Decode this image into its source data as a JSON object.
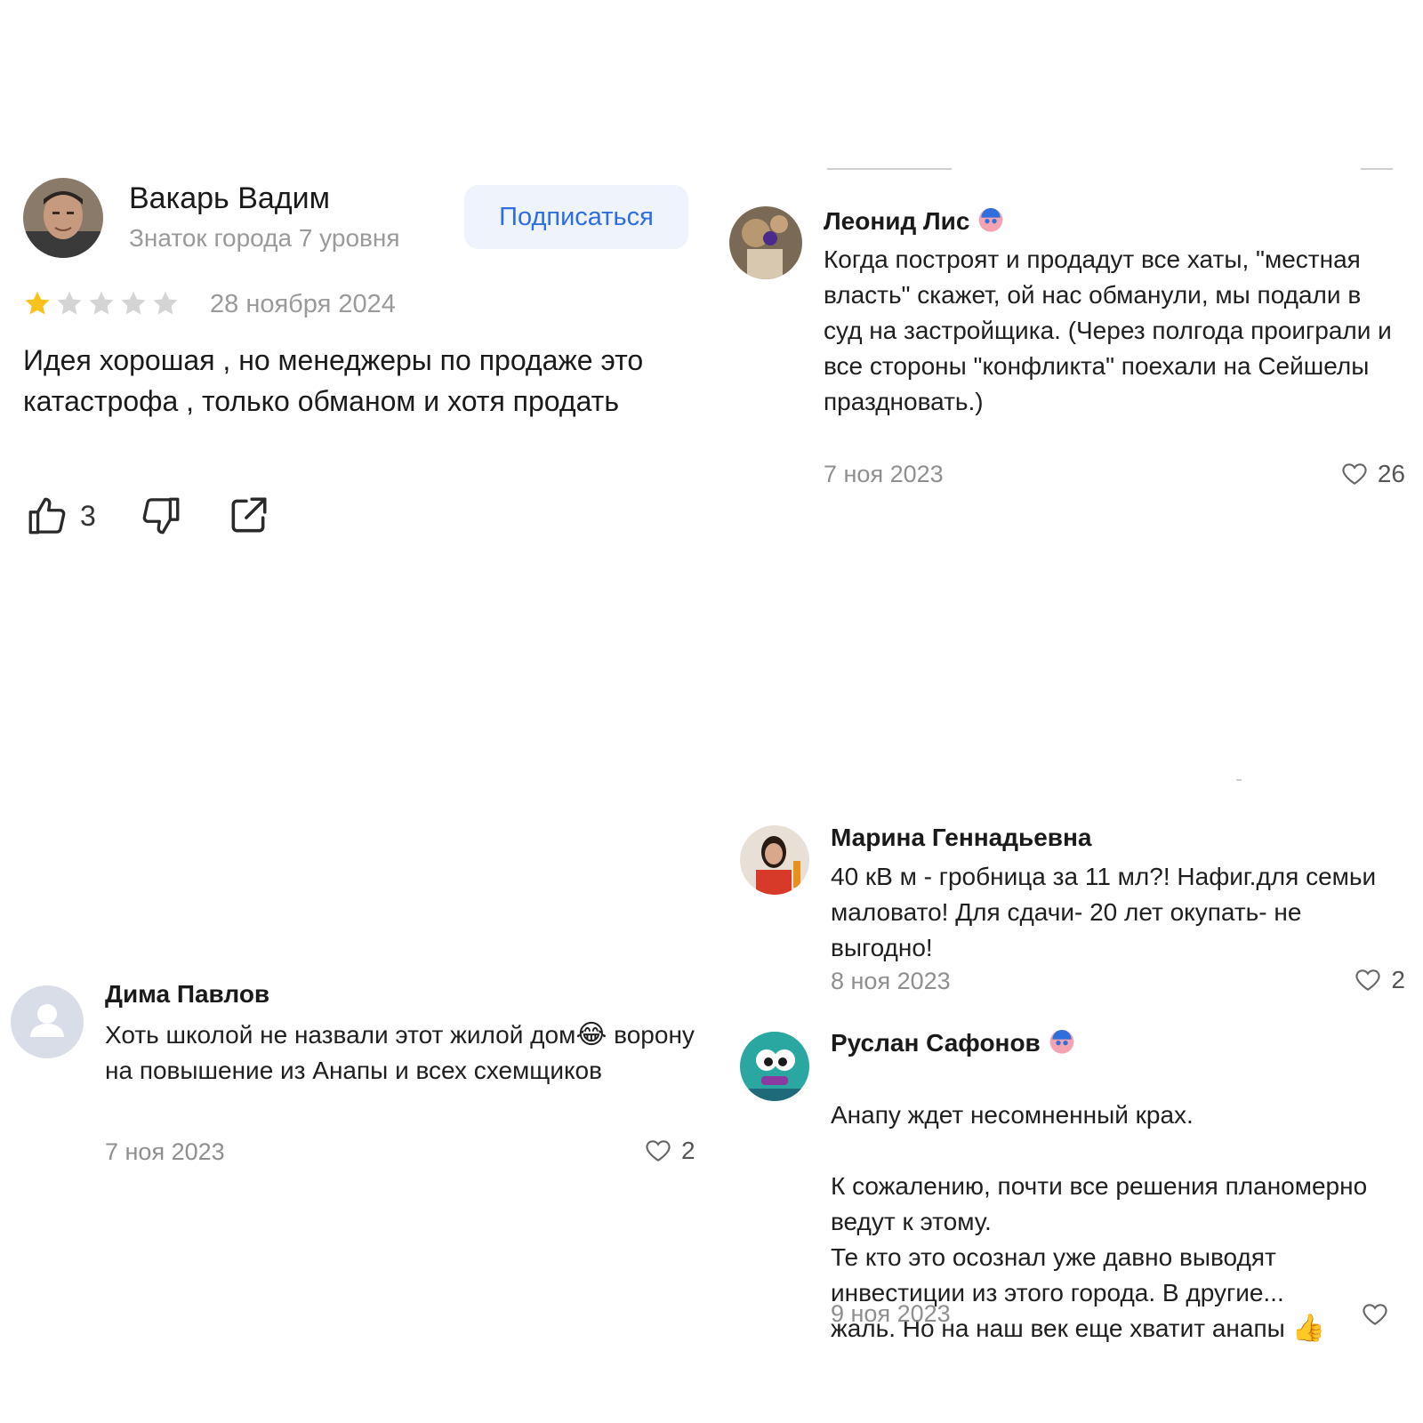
{
  "review": {
    "author": "Вакарь Вадим",
    "level": "Знаток города 7 уровня",
    "subscribe_label": "Подписаться",
    "rating": 1,
    "rating_max": 5,
    "date": "28 ноября 2024",
    "text": "Идея хорошая , но менеджеры по продаже это катастрофа , только обманом и хотя продать",
    "likes": "3",
    "icons": [
      "thumbs-up-icon",
      "thumbs-down-icon",
      "share-icon",
      "star-icon"
    ],
    "colors": {
      "star_active": "#f8c21c",
      "star_inactive": "#d4d4d4",
      "accent": "#2e6ee0"
    }
  },
  "comments": [
    {
      "author": "Леонид Лис",
      "text": "Когда построят и продадут все хаты, \"местная власть\" скажет, ой нас обманули, мы подали в суд на застройщика. (Через полгода проиграли и все стороны \"конфликта\" поехали на Сейшелы праздновать.)",
      "date": "7 ноя 2023",
      "likes": "26",
      "badge": "expert-badge-icon"
    },
    {
      "author": "Марина Геннадьевна",
      "text": "40 кВ м - гробница за 11 мл?! Нафиг.для семьи маловато! Для сдачи- 20 лет окупать- не выгодно!",
      "date": "8 ноя 2023",
      "likes": "2"
    },
    {
      "author": "Дима Павлов",
      "text": "Хоть школой не назвали этот жилой дом",
      "emoji": "😂",
      "text_rest": "ворону на повышение из Анапы и всех схемщиков",
      "date": "7 ноя 2023",
      "likes": "2"
    },
    {
      "author": "Руслан Сафонов",
      "text": "Анапу ждет несомненный крах.\n\nК сожалению, почти все решения планомерно ведут к этому.\nТе кто это осознал уже давно выводят инвестиции из этого города. В другие...\nжаль. Но на наш век еще хватит анапы",
      "emoji": "👍",
      "date": "9 ноя 2023",
      "likes": "",
      "badge": "expert-badge-icon"
    }
  ]
}
